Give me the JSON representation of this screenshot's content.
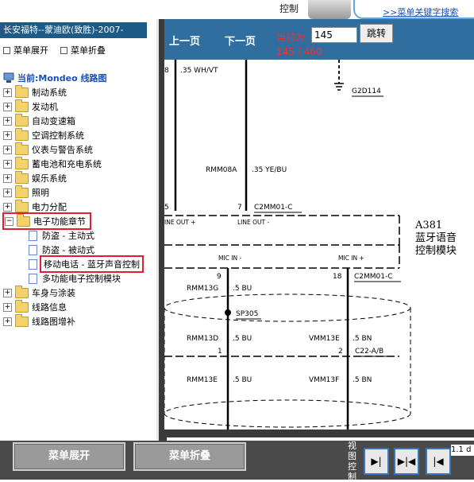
{
  "top": {
    "control_label": "控制",
    "search_link": ">>菜单关键字搜索"
  },
  "left_panel": {
    "vehicle_title": "长安福特--蒙迪欧(致胜)-2007-",
    "expand_label": "菜单展开",
    "collapse_label": "菜单折叠",
    "current_label": "当前:Mondeo 线路图",
    "tree": [
      {
        "label": "制动系统"
      },
      {
        "label": "发动机"
      },
      {
        "label": "自动变速箱"
      },
      {
        "label": "空调控制系统"
      },
      {
        "label": "仪表与警告系统"
      },
      {
        "label": "蓄电池和充电系统"
      },
      {
        "label": "娱乐系统"
      },
      {
        "label": "照明"
      },
      {
        "label": "电力分配"
      },
      {
        "label": "电子功能章节",
        "expanded": true,
        "children": [
          {
            "label": "防盗 - 主动式"
          },
          {
            "label": "防盗 - 被动式"
          },
          {
            "label": "移动电话 - 蓝牙声音控制",
            "selected": true
          },
          {
            "label": "多功能电子控制模块"
          }
        ]
      },
      {
        "label": "车身与涂装"
      },
      {
        "label": "线路信息"
      },
      {
        "label": "线路图增补"
      }
    ]
  },
  "nav": {
    "prev_label": "上一页",
    "next_label": "下一页",
    "current_label": "当前为",
    "page_value": "145",
    "jump_label": "跳转",
    "page_count": "145 / 460"
  },
  "diagram": {
    "labels": {
      "wire_top": ".35 WH/VT",
      "pin_top_left": "8",
      "ground": "G2D114",
      "rmm08a": "RMM08A",
      "wire_ye": ".35 YE/BU",
      "pin5": "5",
      "pin7": "7",
      "c2mm01": "C2MM01-C",
      "line_out_left": "INE OUT +",
      "line_out": "LINE OUT -",
      "module_code": "A381",
      "module_name_1": "蓝牙语音",
      "module_name_2": "控制模块",
      "mic_in_minus": "MIC IN -",
      "mic_in_plus": "MIC IN +",
      "pin9": "9",
      "pin18": "18",
      "c2mm01_b": "C2MM01-C",
      "rmm13g": "RMM13G",
      "bu_1": ".5 BU",
      "sp305": "SP305",
      "rmm13d": "RMM13D",
      "bu_2": ".5 BU",
      "vmm13e": "VMM13E",
      "bn_1": ".5 BN",
      "pin1": "1",
      "pin2": "2",
      "c22": "C22-A/B",
      "rmm13e": "RMM13E",
      "bu_3": ".5 BU",
      "vmm13f": "VMM13F",
      "bn_2": ".5 BN"
    }
  },
  "bottom": {
    "expand_label": "菜单展开",
    "collapse_label": "菜单折叠",
    "view_label": "视图控制",
    "zoom_readout": "1.1 d"
  }
}
